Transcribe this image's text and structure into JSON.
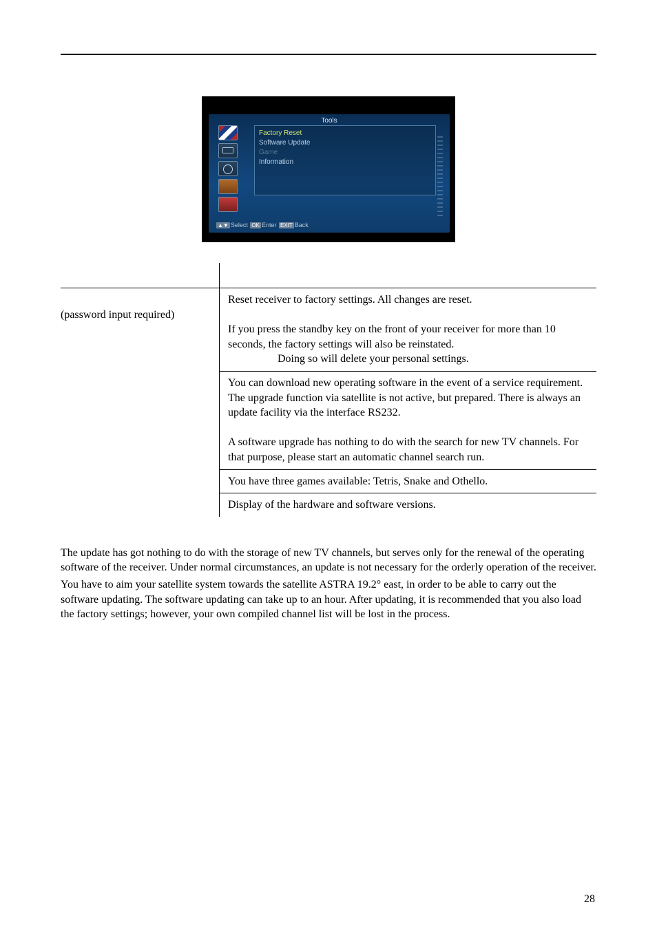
{
  "screenshot": {
    "title": "Tools",
    "menu": {
      "items": [
        "Factory Reset",
        "Software Update",
        "Game",
        "Information"
      ]
    },
    "hint": {
      "select": "Select",
      "enter": "Enter",
      "back": "Back"
    }
  },
  "table": {
    "left_note": "(password input required)",
    "r1a": "Reset receiver to factory settings. All changes are reset.",
    "r1b": "If you press the standby key on the front of your receiver for more than 10 seconds, the factory settings will also be reinstated.",
    "r1c": "Doing so will delete your personal settings.",
    "r2a": "You can download new operating software in the event of a service requirement. The upgrade function via satellite is not active, but prepared. There is always an update facility via the interface RS232.",
    "r2b": "A software upgrade has nothing to do with the search for new TV channels. For that purpose, please start an automatic channel search run.",
    "r3": "You have three games available: Tetris, Snake and Othello.",
    "r4": "Display of the hardware and software versions."
  },
  "body": {
    "p1": "The update has got nothing to do with the storage of new TV channels, but serves only for the renewal of the operating software of the receiver. Under normal circumstances, an update is not necessary for the orderly operation of the receiver.",
    "p2": "You have to aim your satellite system towards the satellite ASTRA 19.2° east, in order to be able to carry out the software updating. The software updating can take up to an hour. After updating, it is recommended that you also load the factory settings; however, your own compiled channel list will be lost in the process."
  },
  "page_number": "28"
}
